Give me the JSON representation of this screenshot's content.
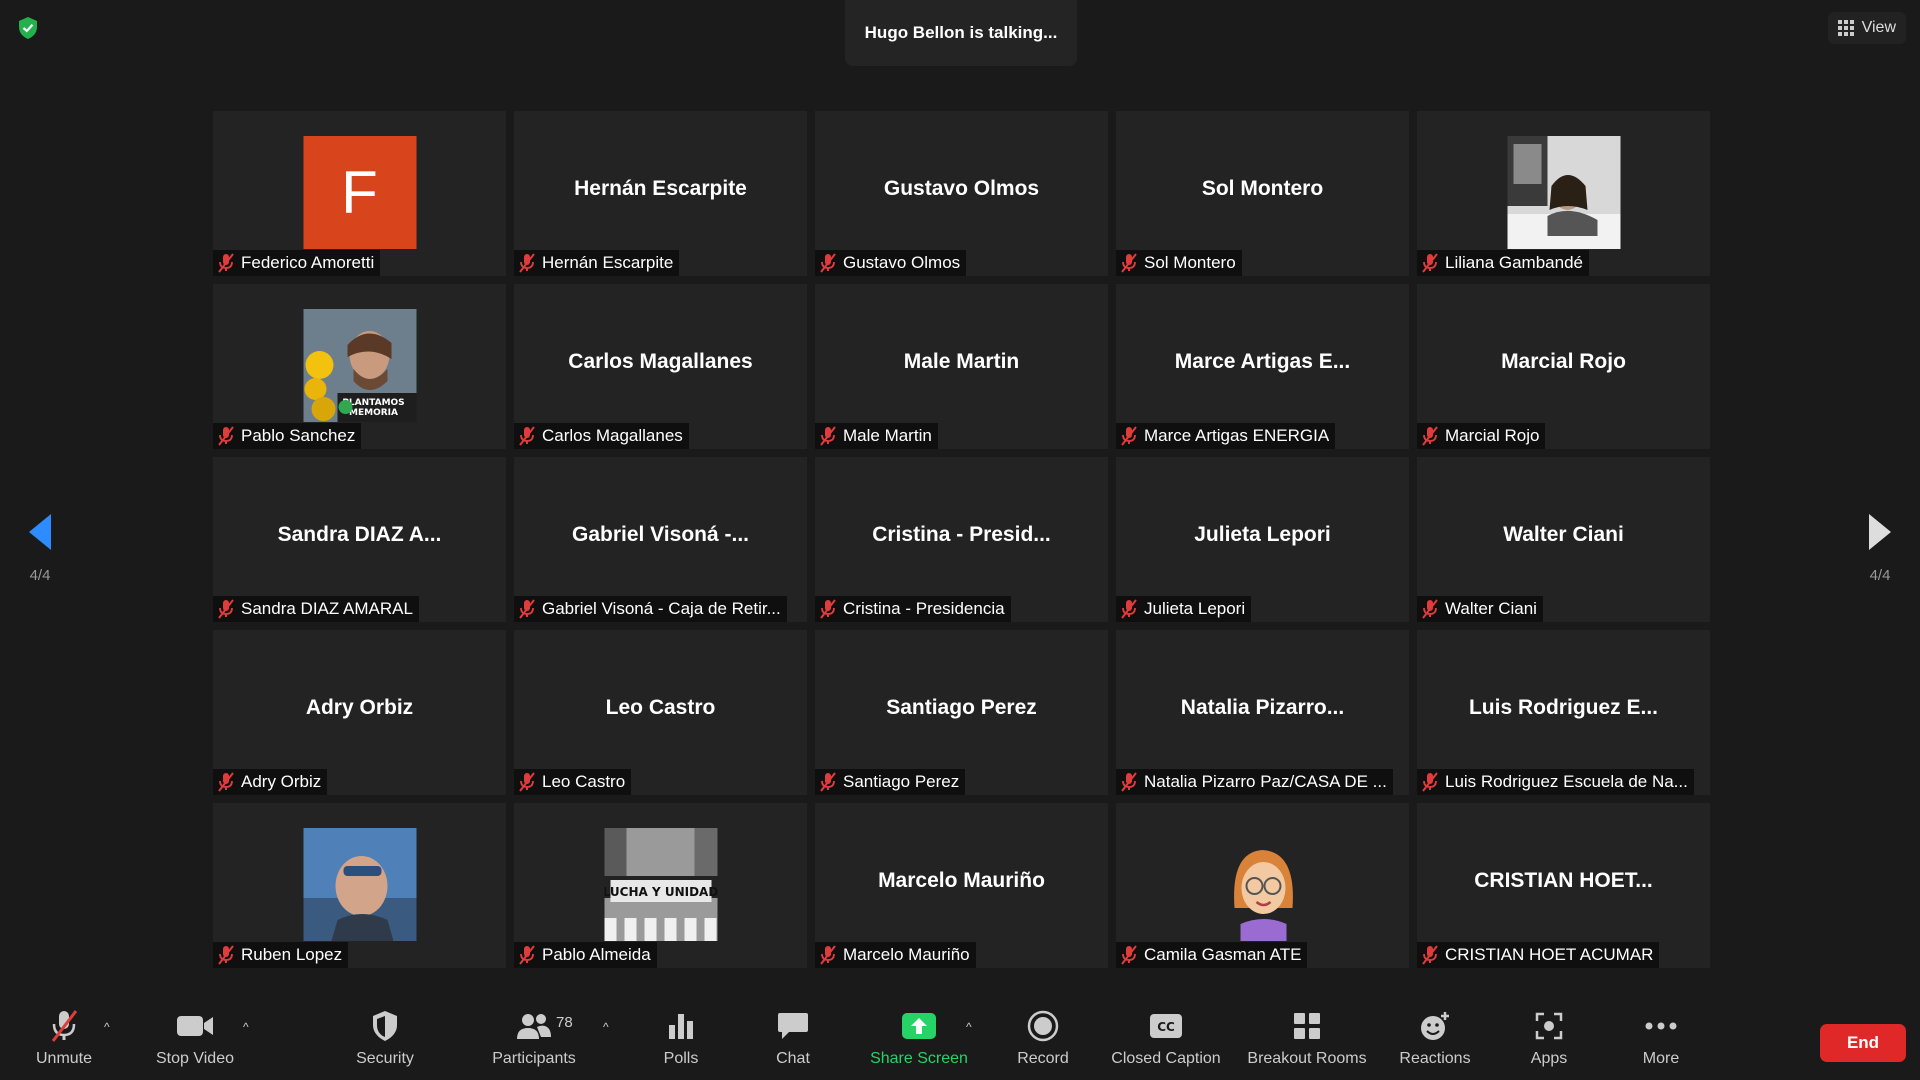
{
  "talking_banner": "Hugo Bellon is talking...",
  "view_button": "View",
  "page_indicator_left": "4/4",
  "page_indicator_right": "4/4",
  "colors": {
    "accent_blue": "#2d8cff",
    "end_red": "#e02828",
    "share_green": "#25d366",
    "mic_red": "#e03c3c"
  },
  "participants": [
    {
      "big": "",
      "label": "Federico Amoretti",
      "avatar": "letter-f",
      "letter": "F"
    },
    {
      "big": "Hernán Escarpite",
      "label": "Hernán Escarpite"
    },
    {
      "big": "Gustavo Olmos",
      "label": "Gustavo Olmos"
    },
    {
      "big": "Sol Montero",
      "label": "Sol Montero"
    },
    {
      "big": "",
      "label": "Liliana Gambandé",
      "avatar": "photo-liliana"
    },
    {
      "big": "",
      "label": "Pablo Sanchez",
      "avatar": "photo-pablo"
    },
    {
      "big": "Carlos Magallanes",
      "label": "Carlos Magallanes"
    },
    {
      "big": "Male Martin",
      "label": "Male Martin"
    },
    {
      "big": "Marce Artigas E...",
      "label": "Marce Artigas ENERGIA"
    },
    {
      "big": "Marcial Rojo",
      "label": "Marcial Rojo"
    },
    {
      "big": "Sandra DIAZ A...",
      "label": "Sandra DIAZ AMARAL"
    },
    {
      "big": "Gabriel Visoná -...",
      "label": "Gabriel Visoná - Caja de Retir..."
    },
    {
      "big": "Cristina - Presid...",
      "label": "Cristina - Presidencia"
    },
    {
      "big": "Julieta Lepori",
      "label": "Julieta Lepori"
    },
    {
      "big": "Walter Ciani",
      "label": "Walter Ciani"
    },
    {
      "big": "Adry Orbiz",
      "label": "Adry Orbiz"
    },
    {
      "big": "Leo Castro",
      "label": "Leo Castro"
    },
    {
      "big": "Santiago Perez",
      "label": "Santiago Perez"
    },
    {
      "big": "Natalia Pizarro...",
      "label": "Natalia Pizarro Paz/CASA DE ..."
    },
    {
      "big": "Luis Rodriguez E...",
      "label": "Luis Rodriguez Escuela de Na..."
    },
    {
      "big": "",
      "label": "Ruben Lopez",
      "avatar": "photo-ruben"
    },
    {
      "big": "",
      "label": "Pablo Almeida",
      "avatar": "photo-banner"
    },
    {
      "big": "Marcelo Mauriño",
      "label": "Marcelo Mauriño"
    },
    {
      "big": "",
      "label": "Camila Gasman ATE",
      "avatar": "memoji"
    },
    {
      "big": "CRISTIAN HOET...",
      "label": "CRISTIAN HOET ACUMAR"
    }
  ],
  "avatar_text": {
    "pablo_banner": "PLANTAMOS MEMORIA",
    "almeida_banner": "LUCHA Y UNIDAD"
  },
  "toolbar": {
    "unmute": "Unmute",
    "stop_video": "Stop Video",
    "security": "Security",
    "participants": "Participants",
    "participants_count": "78",
    "polls": "Polls",
    "chat": "Chat",
    "share_screen": "Share Screen",
    "record": "Record",
    "closed_caption": "Closed Caption",
    "breakout_rooms": "Breakout Rooms",
    "reactions": "Reactions",
    "apps": "Apps",
    "more": "More",
    "end": "End"
  }
}
